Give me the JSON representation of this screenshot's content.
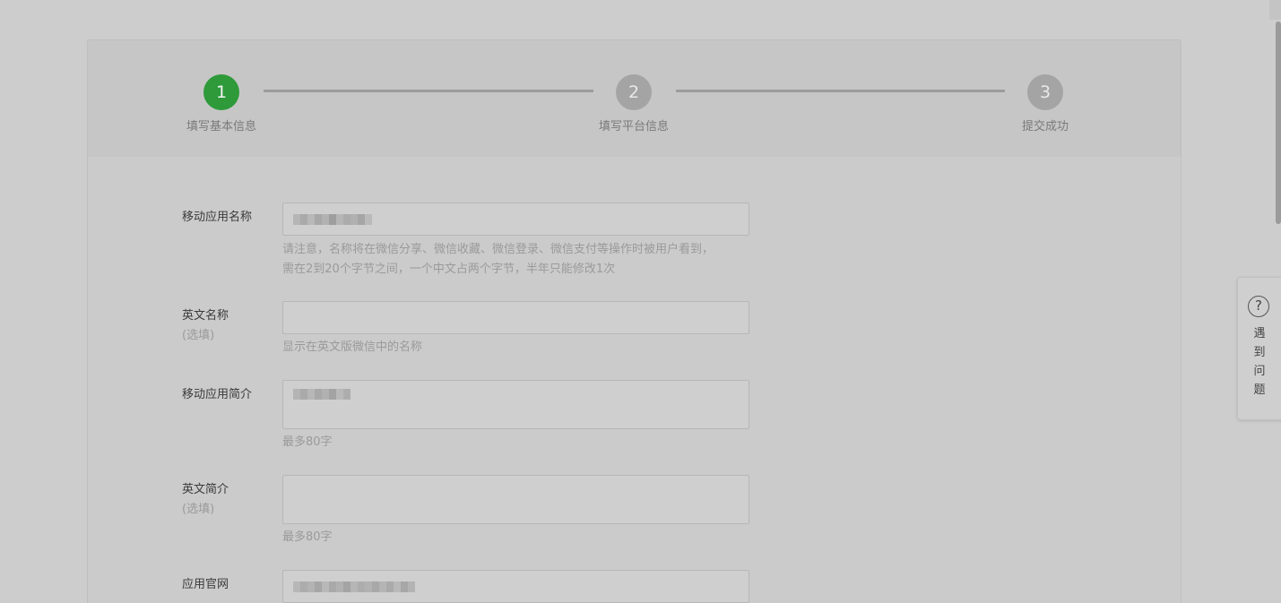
{
  "steps": [
    {
      "number": "1",
      "label": "填写基本信息"
    },
    {
      "number": "2",
      "label": "填写平台信息"
    },
    {
      "number": "3",
      "label": "提交成功"
    }
  ],
  "form": {
    "app_name": {
      "label": "移动应用名称",
      "hint_line1": "请注意，名称将在微信分享、微信收藏、微信登录、微信支付等操作时被用户看到，",
      "hint_line2": "需在2到20个字节之间，一个中文占两个字节，半年只能修改1次"
    },
    "english_name": {
      "label": "英文名称",
      "optional": "(选填)",
      "hint": "显示在英文版微信中的名称"
    },
    "app_intro": {
      "label": "移动应用简介",
      "hint": "最多80字"
    },
    "english_intro": {
      "label": "英文简介",
      "optional": "(选填)",
      "hint": "最多80字"
    },
    "website": {
      "label": "应用官网"
    }
  },
  "help": {
    "icon": "question-circle-icon",
    "icon_glyph": "?",
    "chars": [
      "遇",
      "到",
      "问",
      "题"
    ]
  },
  "colors": {
    "active_step": "#2e9a3a",
    "inactive_step": "#a4a4a4"
  }
}
